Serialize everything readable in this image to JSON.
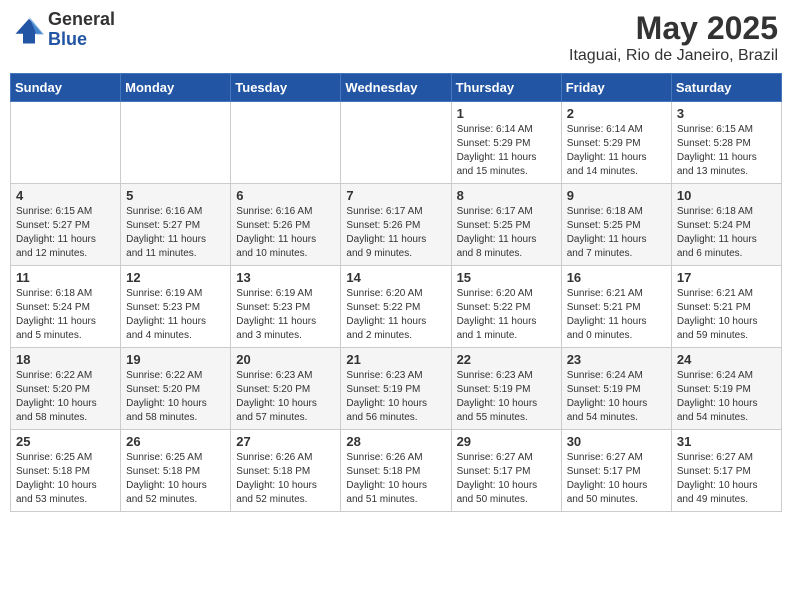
{
  "header": {
    "logo_general": "General",
    "logo_blue": "Blue",
    "month_year": "May 2025",
    "location": "Itaguai, Rio de Janeiro, Brazil"
  },
  "weekdays": [
    "Sunday",
    "Monday",
    "Tuesday",
    "Wednesday",
    "Thursday",
    "Friday",
    "Saturday"
  ],
  "weeks": [
    [
      {
        "day": "",
        "info": ""
      },
      {
        "day": "",
        "info": ""
      },
      {
        "day": "",
        "info": ""
      },
      {
        "day": "",
        "info": ""
      },
      {
        "day": "1",
        "info": "Sunrise: 6:14 AM\nSunset: 5:29 PM\nDaylight: 11 hours\nand 15 minutes."
      },
      {
        "day": "2",
        "info": "Sunrise: 6:14 AM\nSunset: 5:29 PM\nDaylight: 11 hours\nand 14 minutes."
      },
      {
        "day": "3",
        "info": "Sunrise: 6:15 AM\nSunset: 5:28 PM\nDaylight: 11 hours\nand 13 minutes."
      }
    ],
    [
      {
        "day": "4",
        "info": "Sunrise: 6:15 AM\nSunset: 5:27 PM\nDaylight: 11 hours\nand 12 minutes."
      },
      {
        "day": "5",
        "info": "Sunrise: 6:16 AM\nSunset: 5:27 PM\nDaylight: 11 hours\nand 11 minutes."
      },
      {
        "day": "6",
        "info": "Sunrise: 6:16 AM\nSunset: 5:26 PM\nDaylight: 11 hours\nand 10 minutes."
      },
      {
        "day": "7",
        "info": "Sunrise: 6:17 AM\nSunset: 5:26 PM\nDaylight: 11 hours\nand 9 minutes."
      },
      {
        "day": "8",
        "info": "Sunrise: 6:17 AM\nSunset: 5:25 PM\nDaylight: 11 hours\nand 8 minutes."
      },
      {
        "day": "9",
        "info": "Sunrise: 6:18 AM\nSunset: 5:25 PM\nDaylight: 11 hours\nand 7 minutes."
      },
      {
        "day": "10",
        "info": "Sunrise: 6:18 AM\nSunset: 5:24 PM\nDaylight: 11 hours\nand 6 minutes."
      }
    ],
    [
      {
        "day": "11",
        "info": "Sunrise: 6:18 AM\nSunset: 5:24 PM\nDaylight: 11 hours\nand 5 minutes."
      },
      {
        "day": "12",
        "info": "Sunrise: 6:19 AM\nSunset: 5:23 PM\nDaylight: 11 hours\nand 4 minutes."
      },
      {
        "day": "13",
        "info": "Sunrise: 6:19 AM\nSunset: 5:23 PM\nDaylight: 11 hours\nand 3 minutes."
      },
      {
        "day": "14",
        "info": "Sunrise: 6:20 AM\nSunset: 5:22 PM\nDaylight: 11 hours\nand 2 minutes."
      },
      {
        "day": "15",
        "info": "Sunrise: 6:20 AM\nSunset: 5:22 PM\nDaylight: 11 hours\nand 1 minute."
      },
      {
        "day": "16",
        "info": "Sunrise: 6:21 AM\nSunset: 5:21 PM\nDaylight: 11 hours\nand 0 minutes."
      },
      {
        "day": "17",
        "info": "Sunrise: 6:21 AM\nSunset: 5:21 PM\nDaylight: 10 hours\nand 59 minutes."
      }
    ],
    [
      {
        "day": "18",
        "info": "Sunrise: 6:22 AM\nSunset: 5:20 PM\nDaylight: 10 hours\nand 58 minutes."
      },
      {
        "day": "19",
        "info": "Sunrise: 6:22 AM\nSunset: 5:20 PM\nDaylight: 10 hours\nand 58 minutes."
      },
      {
        "day": "20",
        "info": "Sunrise: 6:23 AM\nSunset: 5:20 PM\nDaylight: 10 hours\nand 57 minutes."
      },
      {
        "day": "21",
        "info": "Sunrise: 6:23 AM\nSunset: 5:19 PM\nDaylight: 10 hours\nand 56 minutes."
      },
      {
        "day": "22",
        "info": "Sunrise: 6:23 AM\nSunset: 5:19 PM\nDaylight: 10 hours\nand 55 minutes."
      },
      {
        "day": "23",
        "info": "Sunrise: 6:24 AM\nSunset: 5:19 PM\nDaylight: 10 hours\nand 54 minutes."
      },
      {
        "day": "24",
        "info": "Sunrise: 6:24 AM\nSunset: 5:19 PM\nDaylight: 10 hours\nand 54 minutes."
      }
    ],
    [
      {
        "day": "25",
        "info": "Sunrise: 6:25 AM\nSunset: 5:18 PM\nDaylight: 10 hours\nand 53 minutes."
      },
      {
        "day": "26",
        "info": "Sunrise: 6:25 AM\nSunset: 5:18 PM\nDaylight: 10 hours\nand 52 minutes."
      },
      {
        "day": "27",
        "info": "Sunrise: 6:26 AM\nSunset: 5:18 PM\nDaylight: 10 hours\nand 52 minutes."
      },
      {
        "day": "28",
        "info": "Sunrise: 6:26 AM\nSunset: 5:18 PM\nDaylight: 10 hours\nand 51 minutes."
      },
      {
        "day": "29",
        "info": "Sunrise: 6:27 AM\nSunset: 5:17 PM\nDaylight: 10 hours\nand 50 minutes."
      },
      {
        "day": "30",
        "info": "Sunrise: 6:27 AM\nSunset: 5:17 PM\nDaylight: 10 hours\nand 50 minutes."
      },
      {
        "day": "31",
        "info": "Sunrise: 6:27 AM\nSunset: 5:17 PM\nDaylight: 10 hours\nand 49 minutes."
      }
    ]
  ]
}
